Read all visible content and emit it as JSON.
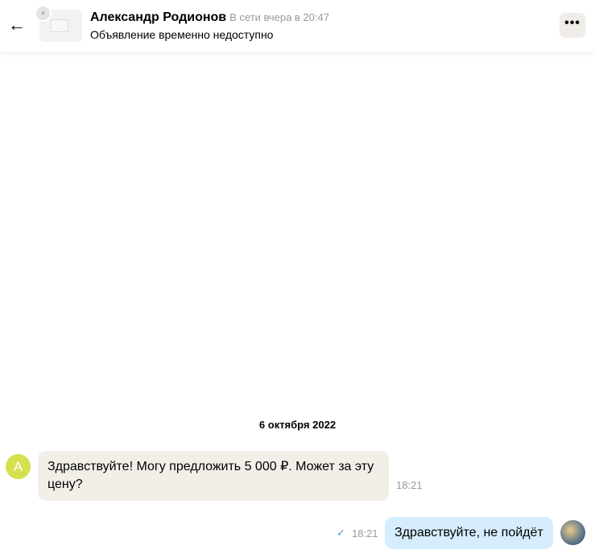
{
  "header": {
    "name": "Александр Родионов",
    "status": "В сети вчера в 20:47",
    "listing": "Объявление временно недоступно"
  },
  "date_separator": "6 октября 2022",
  "messages": [
    {
      "from": "Александр Родионов",
      "avatar_letter": "A",
      "text": "Здравствуйте! Могу предложить 5 000 ₽. Может за эту цену?",
      "time": "18:21"
    },
    {
      "from": "me",
      "text": "Здравствуйте, не пойдёт",
      "time": "18:21",
      "read_icon": "check-icon"
    }
  ],
  "colors": {
    "incoming_bubble": "#f2efe9",
    "outgoing_bubble": "#d6edfd",
    "avatar": "#d5e04e"
  }
}
